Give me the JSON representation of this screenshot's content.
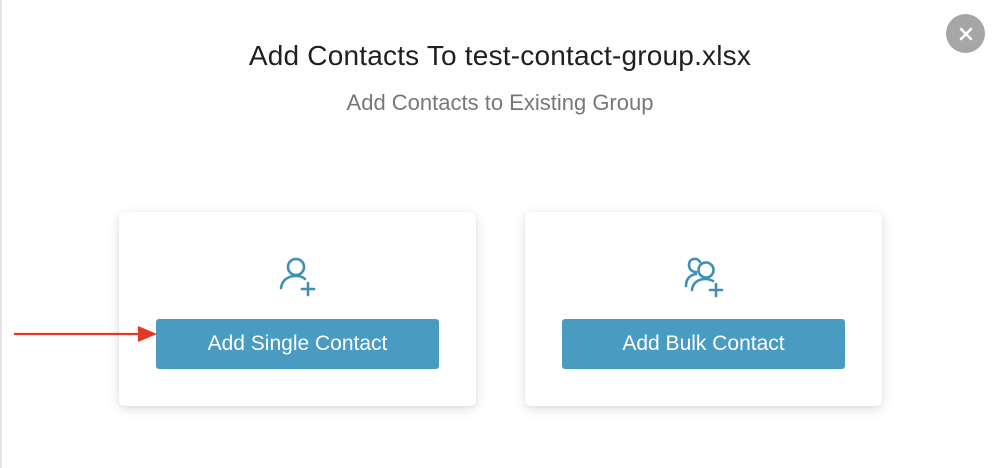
{
  "modal": {
    "title": "Add Contacts To test-contact-group.xlsx",
    "subtitle": "Add Contacts to Existing Group",
    "close_icon": "close-icon"
  },
  "options": [
    {
      "icon": "user-plus-icon",
      "button_label": "Add Single Contact"
    },
    {
      "icon": "users-plus-icon",
      "button_label": "Add Bulk Contact"
    }
  ],
  "annotation": {
    "icon": "red-arrow-icon"
  },
  "colors": {
    "accent": "#4a9bc1",
    "icon": "#3d8fb6",
    "arrow": "#e03a26",
    "close_bg": "#a6a6a6"
  }
}
